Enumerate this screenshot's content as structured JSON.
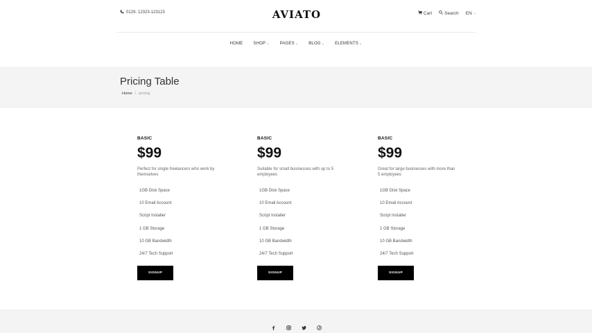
{
  "header": {
    "phone": "0129- 12323-123123",
    "logo": "AVIATO",
    "cart": "Cart",
    "search": "Search",
    "language": "EN"
  },
  "nav": {
    "items": [
      {
        "label": "HOME",
        "has_dropdown": false
      },
      {
        "label": "SHOP",
        "has_dropdown": true
      },
      {
        "label": "PAGES",
        "has_dropdown": true
      },
      {
        "label": "BLOG",
        "has_dropdown": true
      },
      {
        "label": "ELEMENTS",
        "has_dropdown": true
      }
    ]
  },
  "page": {
    "title": "Pricing Table",
    "breadcrumb": {
      "home": "Home",
      "separator": "/",
      "current": "pricing"
    }
  },
  "plans": [
    {
      "name": "BASIC",
      "price": "$99",
      "description": "Perfect for single freelancers who work by themselves",
      "features": [
        "1GB Disk Space",
        "10 Email Account",
        "Script Installer",
        "1 GB Storage",
        "10 GB Bandwidth",
        "24/7 Tech Support"
      ],
      "button": "SIGNUP"
    },
    {
      "name": "BASIC",
      "price": "$99",
      "description": "Suitable for small businesses with up to 5 employees",
      "features": [
        "1GB Disk Space",
        "10 Email Account",
        "Script Installer",
        "1 GB Storage",
        "10 GB Bandwidth",
        "24/7 Tech Support"
      ],
      "button": "SIGNUP"
    },
    {
      "name": "BASIC",
      "price": "$99",
      "description": "Great for large businesses with more than 5 employees",
      "features": [
        "1GB Disk Space",
        "10 Email Account",
        "Script Installer",
        "1 GB Storage",
        "10 GB Bandwidth",
        "24/7 Tech Support"
      ],
      "button": "SIGNUP"
    }
  ],
  "footer": {
    "social": [
      "facebook-icon",
      "instagram-icon",
      "twitter-icon",
      "pinterest-icon"
    ]
  },
  "colors": {
    "accent": "#000000",
    "band": "#f4f4f4"
  }
}
